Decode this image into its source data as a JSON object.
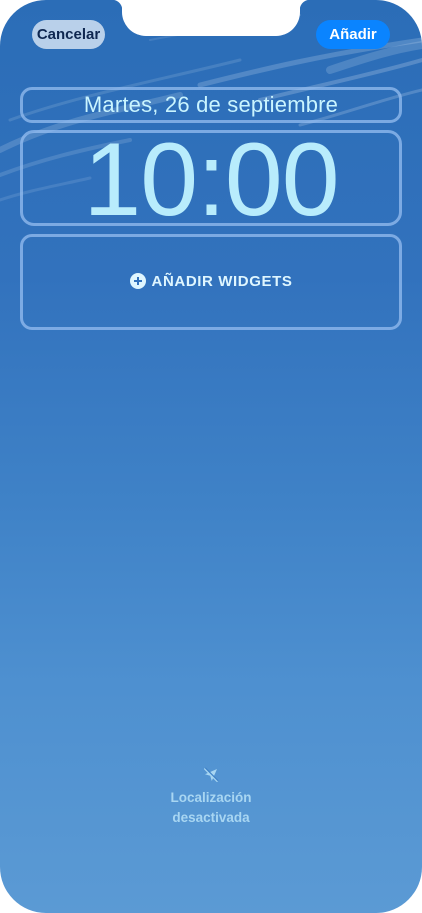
{
  "header": {
    "cancel_label": "Cancelar",
    "add_label": "Añadir"
  },
  "lock_screen": {
    "date": "Martes, 26 de septiembre",
    "time": "10:00",
    "add_widgets_label": "AÑADIR WIDGETS"
  },
  "footer": {
    "location_status": "Localización\ndesactivada",
    "location_icon": "location-slash-icon"
  },
  "colors": {
    "add_button": "#0a84ff",
    "cancel_button": "#cddef0",
    "clock_text": "#b8ecfc",
    "sky_top": "#2b6db7",
    "sky_bottom": "#5b9ad4"
  }
}
